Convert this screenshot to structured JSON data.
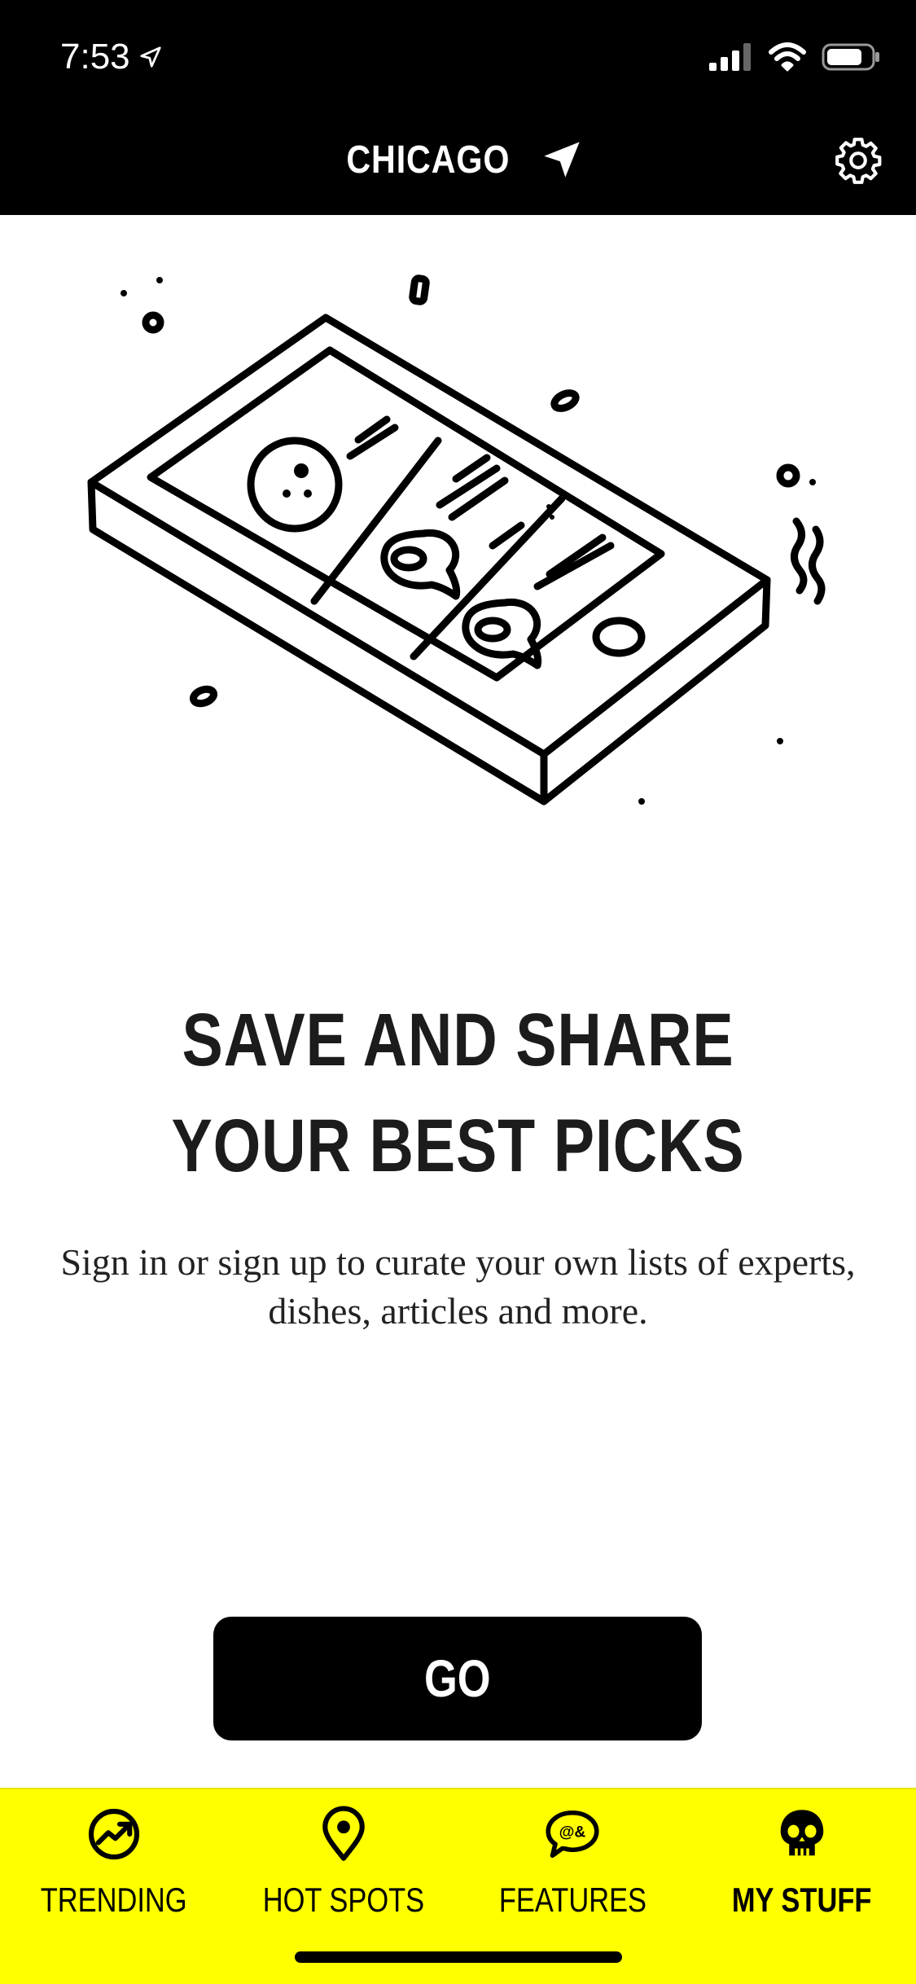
{
  "status_bar": {
    "time": "7:53",
    "icons": [
      "location-arrow-icon",
      "signal-icon",
      "wifi-icon",
      "battery-icon"
    ]
  },
  "header": {
    "city": "CHICAGO",
    "location_icon": "location-arrow-icon",
    "settings_icon": "gear-icon"
  },
  "illustration": {
    "icon": "phone-illustration"
  },
  "promo": {
    "headline_line1": "SAVE AND SHARE",
    "headline_line2": "YOUR BEST PICKS",
    "subtext": "Sign in or sign up to curate your own lists of experts, dishes, articles and more."
  },
  "cta": {
    "label": "GO"
  },
  "tabbar": {
    "tabs": [
      {
        "label": "TRENDING",
        "icon": "trending-icon",
        "active": false
      },
      {
        "label": "HOT SPOTS",
        "icon": "map-pin-icon",
        "active": false
      },
      {
        "label": "FEATURES",
        "icon": "speech-bubble-icon",
        "active": false
      },
      {
        "label": "MY STUFF",
        "icon": "skull-icon",
        "active": true
      }
    ]
  },
  "colors": {
    "header_bg": "#000000",
    "tabbar_bg": "#ffff00",
    "button_bg": "#000000",
    "text_dark": "#1c1c1c"
  }
}
